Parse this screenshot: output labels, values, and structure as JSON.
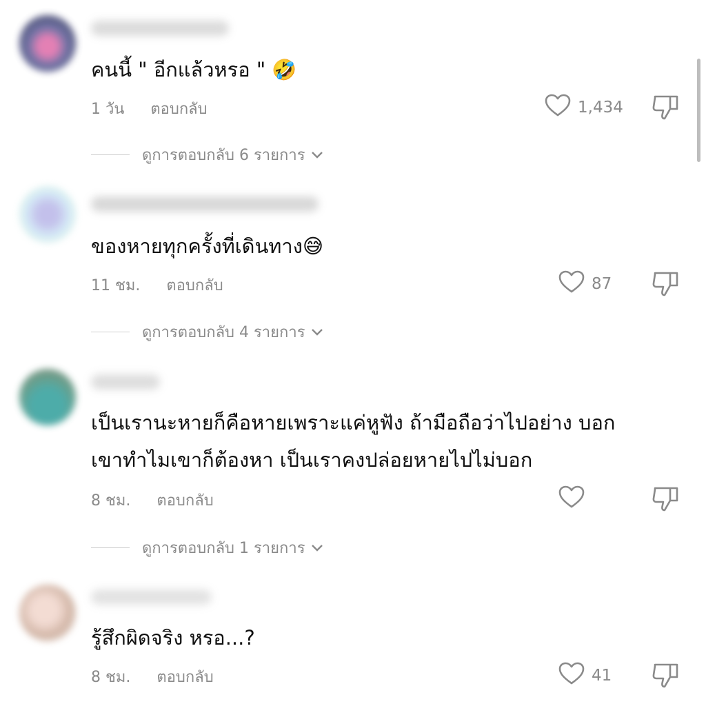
{
  "comments": [
    {
      "text": "คนนี้ \" อีกแล้วหรอ \" 🤣",
      "time": "1 วัน",
      "reply_label": "ตอบกลับ",
      "likes": "1,434",
      "view_replies": "ดูการตอบกลับ 6 รายการ"
    },
    {
      "text": "ของหายทุกครั้งที่เดินทาง😅",
      "time": "11 ชม.",
      "reply_label": "ตอบกลับ",
      "likes": "87",
      "view_replies": "ดูการตอบกลับ 4 รายการ"
    },
    {
      "text": "เป็นเรานะหายก็คือหายเพราะแค่หูฟัง ถ้ามือถือว่าไปอย่าง บอกเขาทำไมเขาก็ต้องหา เป็นเราคงปล่อยหายไปไม่บอก",
      "time": "8 ชม.",
      "reply_label": "ตอบกลับ",
      "likes": "",
      "view_replies": "ดูการตอบกลับ 1 รายการ"
    },
    {
      "text": "รู้สึกผิดจริง หรอ...?",
      "time": "8 ชม.",
      "reply_label": "ตอบกลับ",
      "likes": "41",
      "view_replies": ""
    }
  ],
  "icons": {
    "like": "heart-outline-icon",
    "dislike": "thumbs-down-icon",
    "expand": "chevron-down-icon"
  },
  "colors": {
    "text": "#111111",
    "muted": "#8a8a8a",
    "background": "#ffffff"
  }
}
